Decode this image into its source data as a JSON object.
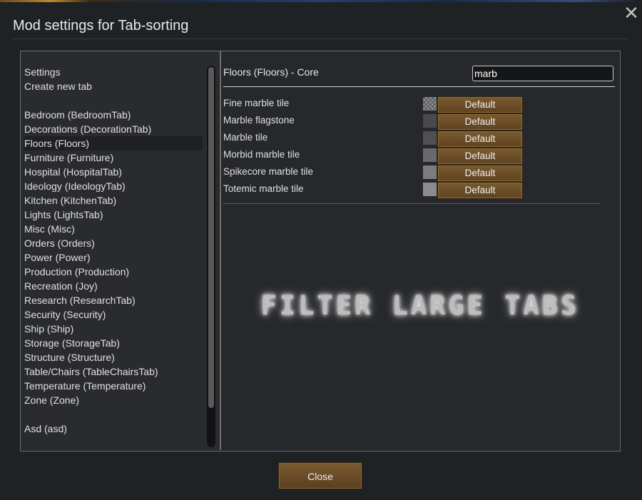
{
  "window": {
    "title": "Mod settings for Tab-sorting",
    "close_glyph": "✕",
    "close_label": "Close"
  },
  "sidebar": {
    "items": [
      "Settings",
      "Create new tab",
      "Bedroom (BedroomTab)",
      "Decorations (DecorationTab)",
      "Floors (Floors)",
      "Furniture (Furniture)",
      "Hospital (HospitalTab)",
      "Ideology (IdeologyTab)",
      "Kitchen (KitchenTab)",
      "Lights (LightsTab)",
      "Misc (Misc)",
      "Orders (Orders)",
      "Power (Power)",
      "Production (Production)",
      "Recreation (Joy)",
      "Research (ResearchTab)",
      "Security (Security)",
      "Ship (Ship)",
      "Storage (StorageTab)",
      "Structure (Structure)",
      "Table/Chairs (TableChairsTab)",
      "Temperature (Temperature)",
      "Zone (Zone)",
      "Asd (asd)"
    ],
    "selected": "Floors (Floors)"
  },
  "panel": {
    "header": "Floors (Floors) - Core",
    "search_value": "marb",
    "rows": [
      {
        "label": "Fine marble tile",
        "button": "Default",
        "swatch_color": "#6e6e6e"
      },
      {
        "label": "Marble flagstone",
        "button": "Default",
        "swatch_color": "#4a4a4a"
      },
      {
        "label": "Marble tile",
        "button": "Default",
        "swatch_color": "#505050"
      },
      {
        "label": "Morbid marble tile",
        "button": "Default",
        "swatch_color": "#6a6a6a"
      },
      {
        "label": "Spikecore marble tile",
        "button": "Default",
        "swatch_color": "#7c7c7c"
      },
      {
        "label": "Totemic marble tile",
        "button": "Default",
        "swatch_color": "#8c8c8c"
      }
    ],
    "watermark": "FILTER LARGE TABS"
  },
  "colors": {
    "button_brown": "#6b4e28",
    "background": "#1f2225"
  }
}
